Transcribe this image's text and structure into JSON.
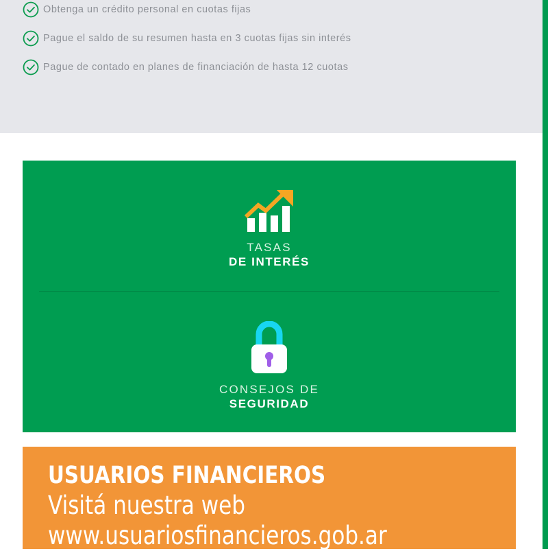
{
  "benefits": {
    "items": [
      {
        "text": "Obtenga un crédito personal en cuotas fijas"
      },
      {
        "text": "Pague el saldo de su resumen hasta en 3 cuotas fijas sin interés"
      },
      {
        "text": "Pague de contado en planes de financiación de hasta 12 cuotas"
      }
    ]
  },
  "features": [
    {
      "line1": "TASAS",
      "line2": "DE INTERÉS",
      "icon": "growth-chart-icon"
    },
    {
      "line1": "CONSEJOS DE",
      "line2": "SEGURIDAD",
      "icon": "padlock-icon"
    }
  ],
  "banner": {
    "title": "USUARIOS FINANCIEROS",
    "line1": "Visitá nuestra web",
    "line2": "www.usuariosfinancieros.gob.ar"
  },
  "colors": {
    "green": "#009d51",
    "orange": "#f29537",
    "gray_bg": "#e6e7eb",
    "check_green": "#0c9c4f",
    "chart_gold": "#f5a623",
    "lock_cyan": "#18d6f0",
    "lock_purple": "#a05ee8"
  }
}
